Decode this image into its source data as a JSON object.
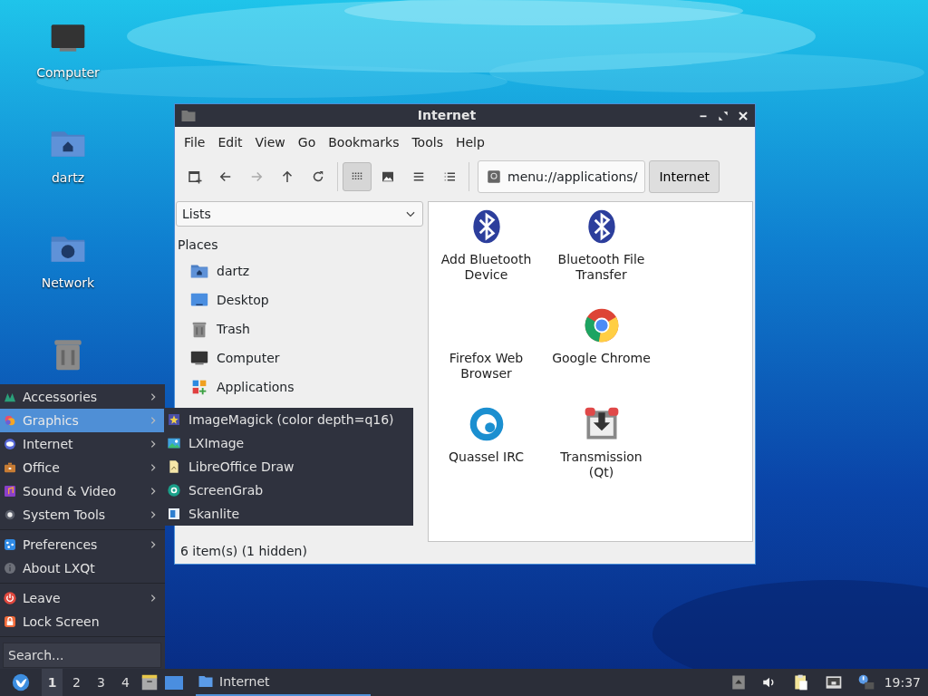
{
  "desktop": {
    "icons": [
      {
        "label": "Computer",
        "kind": "computer"
      },
      {
        "label": "dartz",
        "kind": "home"
      },
      {
        "label": "Network",
        "kind": "network"
      },
      {
        "kind": "trash"
      }
    ]
  },
  "window": {
    "title": "Internet",
    "menus": [
      "File",
      "Edit",
      "View",
      "Go",
      "Bookmarks",
      "Tools",
      "Help"
    ],
    "nav_buttons": [
      {
        "kind": "new-tab",
        "disabled": false
      },
      {
        "kind": "back",
        "disabled": false
      },
      {
        "kind": "forward",
        "disabled": true
      },
      {
        "kind": "up",
        "disabled": false
      },
      {
        "kind": "reload",
        "disabled": false
      }
    ],
    "view_buttons": [
      {
        "kind": "icons",
        "selected": true
      },
      {
        "kind": "thumbnails",
        "selected": false
      },
      {
        "kind": "compact",
        "selected": false
      },
      {
        "kind": "details",
        "selected": false
      }
    ],
    "path": "menu://applications/",
    "breadcrumb": "Internet",
    "side_selector": "Lists",
    "places_heading": "Places",
    "places": [
      {
        "label": "dartz",
        "kind": "home"
      },
      {
        "label": "Desktop",
        "kind": "desktop"
      },
      {
        "label": "Trash",
        "kind": "trash"
      },
      {
        "label": "Computer",
        "kind": "computer"
      },
      {
        "label": "Applications",
        "kind": "apps"
      }
    ],
    "files": [
      {
        "label": "Add Bluetooth Device",
        "kind": "bluetooth"
      },
      {
        "label": "Bluetooth File Transfer",
        "kind": "bluetooth"
      },
      {
        "label": "Firefox Web Browser",
        "kind": "blank"
      },
      {
        "label": "Google Chrome",
        "kind": "chrome"
      },
      {
        "label": "Quassel IRC",
        "kind": "quassel"
      },
      {
        "label": "Transmission (Qt)",
        "kind": "transmission"
      }
    ],
    "status": "6 item(s) (1 hidden)"
  },
  "start_menu": {
    "groups": [
      [
        {
          "label": "Accessories",
          "kind": "accessories",
          "selected": false
        },
        {
          "label": "Graphics",
          "kind": "graphics",
          "selected": true
        },
        {
          "label": "Internet",
          "kind": "internet",
          "selected": false
        },
        {
          "label": "Office",
          "kind": "office",
          "selected": false
        },
        {
          "label": "Sound & Video",
          "kind": "media",
          "selected": false
        },
        {
          "label": "System Tools",
          "kind": "system",
          "selected": false
        }
      ],
      [
        {
          "label": "Preferences",
          "kind": "preferences",
          "selected": false
        },
        {
          "label": "About LXQt",
          "kind": "about",
          "selected": false
        }
      ],
      [
        {
          "label": "Leave",
          "kind": "leave",
          "selected": false
        },
        {
          "label": "Lock Screen",
          "kind": "lock",
          "selected": false
        }
      ]
    ],
    "submenu": [
      {
        "label": "ImageMagick (color depth=q16)",
        "kind": "imagemagick"
      },
      {
        "label": "LXImage",
        "kind": "lximage"
      },
      {
        "label": "LibreOffice Draw",
        "kind": "draw"
      },
      {
        "label": "ScreenGrab",
        "kind": "screengrab"
      },
      {
        "label": "Skanlite",
        "kind": "skanlite"
      }
    ],
    "search": {
      "placeholder": "Search..."
    }
  },
  "taskbar": {
    "desktops": [
      {
        "label": "1",
        "selected": true
      },
      {
        "label": "2",
        "selected": false
      },
      {
        "label": "3",
        "selected": false
      },
      {
        "label": "4",
        "selected": false
      }
    ],
    "task": {
      "label": "Internet",
      "selected": true
    },
    "clock": "19:37"
  }
}
